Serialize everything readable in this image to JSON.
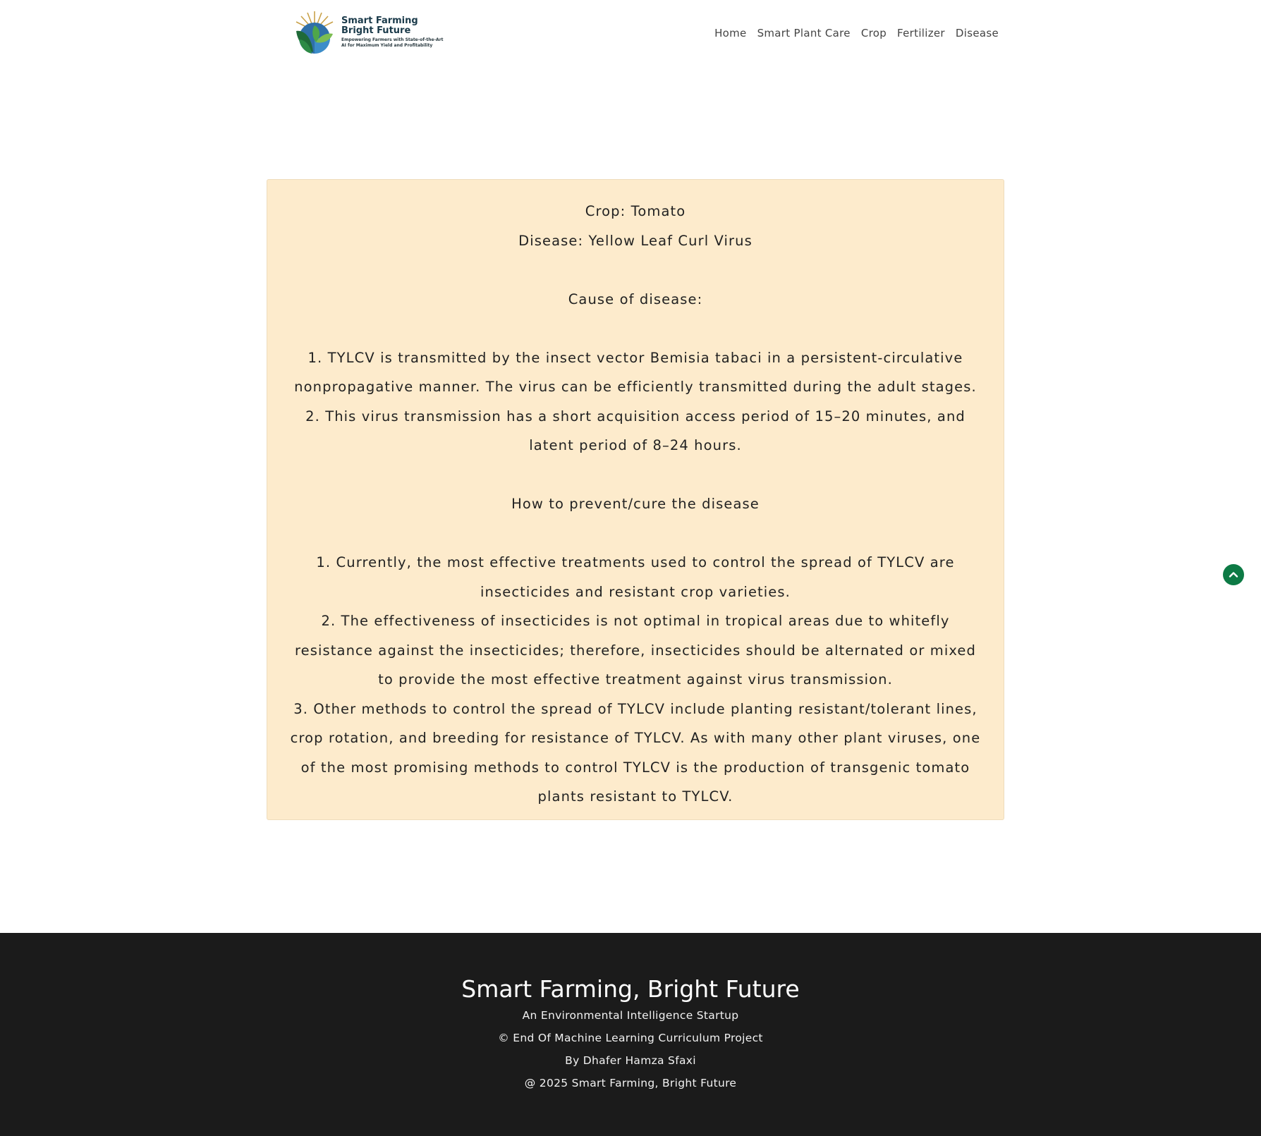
{
  "header": {
    "logo": {
      "title_line1": "Smart Farming",
      "title_line2": "Bright Future",
      "tagline_line1": "Empowering Farmers with State-of-the-Art",
      "tagline_line2": "AI for Maximum Yield and Profitability"
    },
    "nav": [
      {
        "label": "Home"
      },
      {
        "label": "Smart Plant Care"
      },
      {
        "label": "Crop"
      },
      {
        "label": "Fertilizer"
      },
      {
        "label": "Disease"
      }
    ]
  },
  "result": {
    "crop_line": "Crop: Tomato",
    "disease_line": "Disease: Yellow Leaf Curl Virus",
    "cause_heading": "Cause of disease:",
    "causes": [
      "1. TYLCV is transmitted by the insect vector Bemisia tabaci in a persistent-circulative nonpropagative manner. The virus can be efficiently transmitted during the adult stages.",
      "2. This virus transmission has a short acquisition access period of 15–20 minutes, and latent period of 8–24 hours."
    ],
    "prevent_heading": "How to prevent/cure the disease",
    "preventions": [
      "1. Currently, the most effective treatments used to control the spread of TYLCV are insecticides and resistant crop varieties.",
      "2. The effectiveness of insecticides is not optimal in tropical areas due to whitefly resistance against the insecticides; therefore, insecticides should be alternated or mixed to provide the most effective treatment against virus transmission.",
      "3. Other methods to control the spread of TYLCV include planting resistant/tolerant lines, crop rotation, and breeding for resistance of TYLCV. As with many other plant viruses, one of the most promising methods to control TYLCV is the production of transgenic tomato plants resistant to TYLCV."
    ]
  },
  "back_to_top": {
    "icon": "chevron-up-icon",
    "color": "#0d7a45"
  },
  "footer": {
    "title": "Smart Farming, Bright Future",
    "subtitle": "An Environmental Intelligence Startup",
    "project": "© End Of Machine Learning Curriculum Project",
    "author": "By Dhafer Hamza Sfaxi",
    "copyright": "@ 2025 Smart Farming, Bright Future"
  },
  "colors": {
    "card_background": "#fdebcc",
    "footer_background": "#1b1b1b",
    "accent_green": "#0d7a45"
  }
}
